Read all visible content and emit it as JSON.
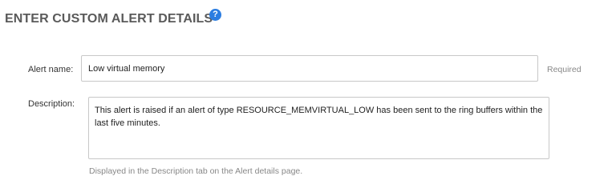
{
  "header": {
    "title": "ENTER CUSTOM ALERT DETAILS",
    "help_glyph": "?"
  },
  "form": {
    "name_label": "Alert name:",
    "name_value": "Low virtual memory",
    "required_note": "Required",
    "description_label": "Description:",
    "description_value": "This alert is raised if an alert of type RESOURCE_MEMVIRTUAL_LOW has been sent to the ring buffers within the last five minutes.",
    "description_help": "Displayed in the Description tab on the Alert details page."
  },
  "icons": {
    "help": "question-circle-icon"
  },
  "colors": {
    "accent": "#2b7de1",
    "title": "#5a5a5a",
    "muted": "#888888",
    "border": "#c8c8c8"
  }
}
